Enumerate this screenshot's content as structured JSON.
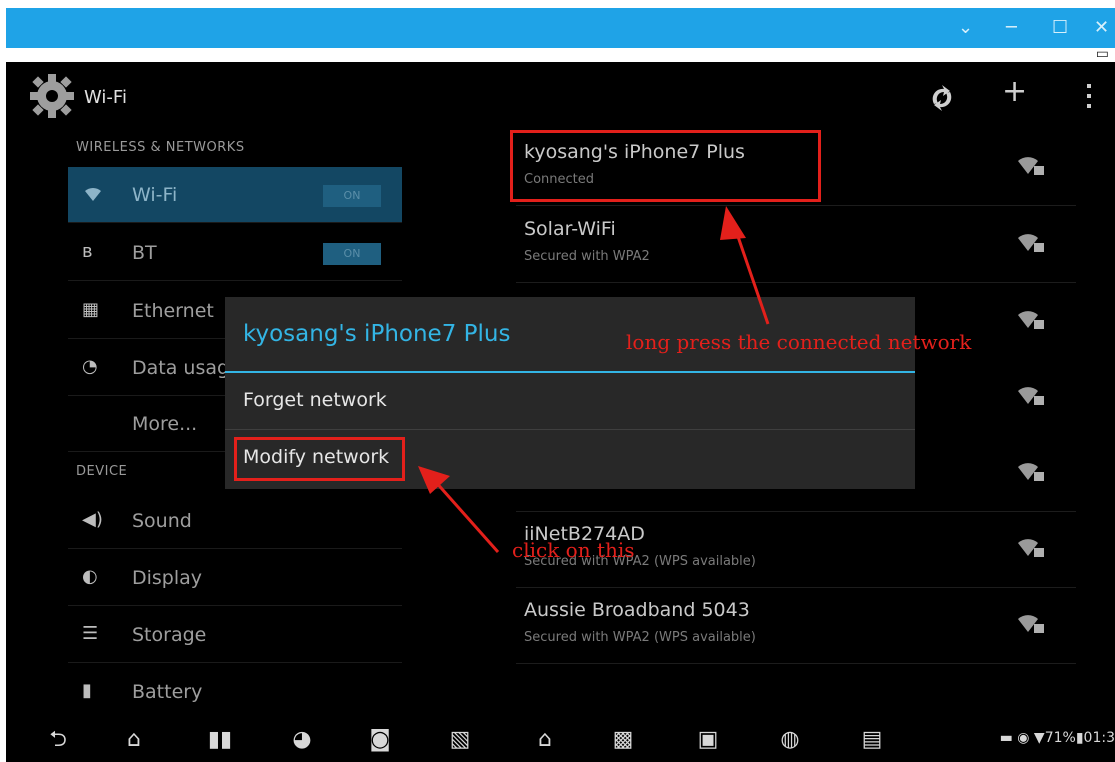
{
  "window_controls": {
    "chevron": "⌄",
    "minimize": "─",
    "maximize": "☐",
    "close": "✕"
  },
  "action_bar": {
    "title": "Wi-Fi",
    "icons": [
      "wps-icon",
      "add-icon",
      "overflow-menu-icon"
    ]
  },
  "sections": {
    "wireless": "WIRELESS & NETWORKS",
    "device": "DEVICE"
  },
  "settings_list": [
    {
      "label": "Wi-Fi",
      "icon": "wifi-icon",
      "toggle": "ON",
      "selected": true
    },
    {
      "label": "BT",
      "icon": "bluetooth-icon",
      "toggle": "ON"
    },
    {
      "label": "Ethernet",
      "icon": "ethernet-icon"
    },
    {
      "label": "Data usage",
      "icon": "data-usage-icon"
    },
    {
      "label": "More...",
      "icon": ""
    },
    {
      "label": "Sound",
      "icon": "sound-icon"
    },
    {
      "label": "Display",
      "icon": "display-icon"
    },
    {
      "label": "Storage",
      "icon": "storage-icon"
    },
    {
      "label": "Battery",
      "icon": "battery-icon"
    }
  ],
  "networks": [
    {
      "name": "kyosang's iPhone7 Plus",
      "status": "Connected"
    },
    {
      "name": "Solar-WiFi",
      "status": "Secured with WPA2"
    },
    {
      "name": "iiNetB274AD",
      "status": "Secured with WPA2 (WPS available)"
    },
    {
      "name": "Aussie Broadband 5043",
      "status": "Secured with WPA2 (WPS available)"
    }
  ],
  "dialog": {
    "title": "kyosang's iPhone7 Plus",
    "items": [
      "Forget network",
      "Modify network"
    ]
  },
  "annotations": {
    "long_press": "long press the connected network",
    "click": "click on this"
  },
  "status_bar": {
    "battery": "71%",
    "time": "01:3"
  },
  "colors": {
    "accent": "#33b5e5",
    "title_bar": "#1fa3e7",
    "annotation": "#e3201b"
  }
}
